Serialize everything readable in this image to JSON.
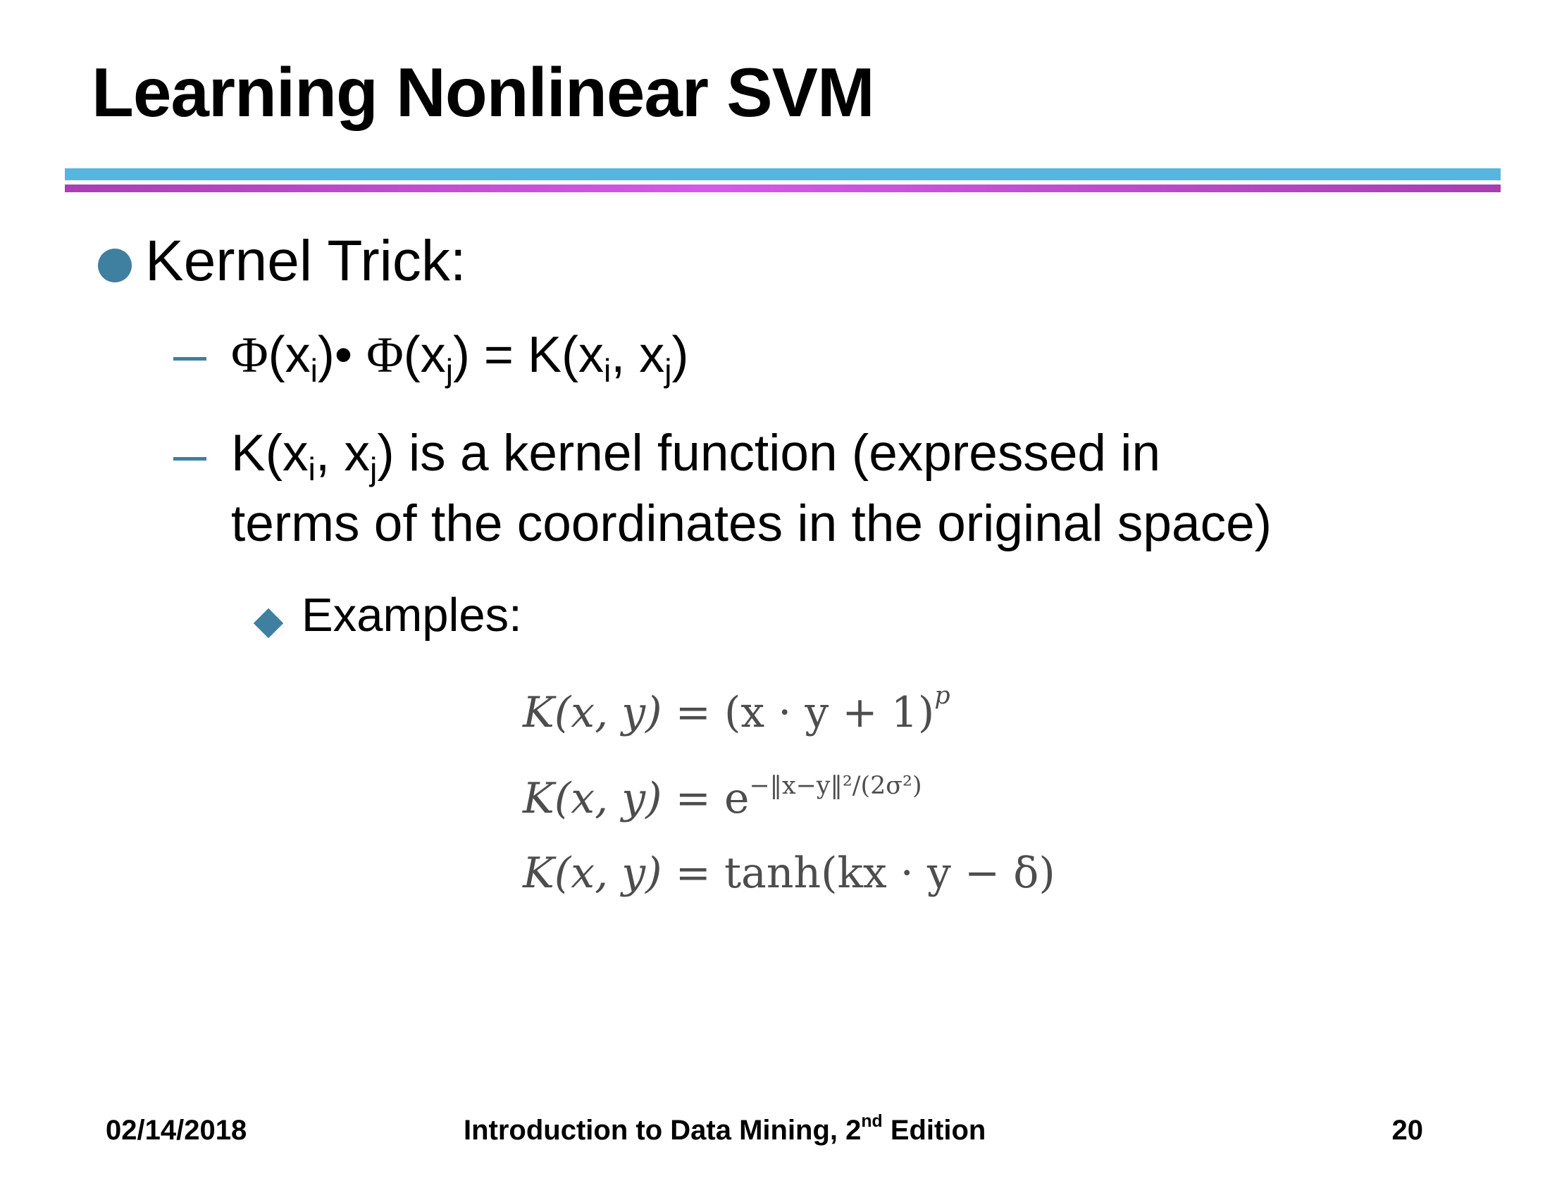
{
  "slide": {
    "title": "Learning Nonlinear SVM"
  },
  "content": {
    "bullet_1": {
      "text": "Kernel Trick:"
    },
    "dash_1": {
      "phi": "Φ",
      "open_paren": "(x",
      "sub_i": "i",
      "close_dot": ")• ",
      "phi2": "Φ",
      "open_paren_2": "(x",
      "sub_j": "j",
      "tail": ") = K(x",
      "sub_i_2": "i",
      "comma": ", x",
      "sub_j_2": "j",
      "end": ")"
    },
    "dash_2": {
      "prefix": "K(x",
      "sub_i": "i",
      "comma": ", x",
      "sub_j": "j",
      "rest_line_1": ") is a kernel function (expressed in",
      "line_2": "terms of the coordinates in the original space)"
    },
    "subbullet": {
      "text": "Examples:"
    },
    "equations": {
      "eq1": {
        "lhs": "K(x, y)",
        "rhs": " = (x · y + 1)",
        "exp": "p"
      },
      "eq2": {
        "lhs": "K(x, y)",
        "rhs": " = e",
        "exp": "−‖x−y‖²/(2σ²)"
      },
      "eq3": {
        "lhs": "K(x, y)",
        "rhs": " = tanh(kx · y − δ)"
      }
    }
  },
  "footer": {
    "date": "02/14/2018",
    "book_prefix": "Introduction to Data Mining, 2",
    "book_sup": "nd",
    "book_suffix": " Edition",
    "page": "20"
  },
  "colors": {
    "accent_blue": "#3f7fa0",
    "rule_blue": "#56b6df",
    "rule_magenta": "#d35ae7"
  }
}
